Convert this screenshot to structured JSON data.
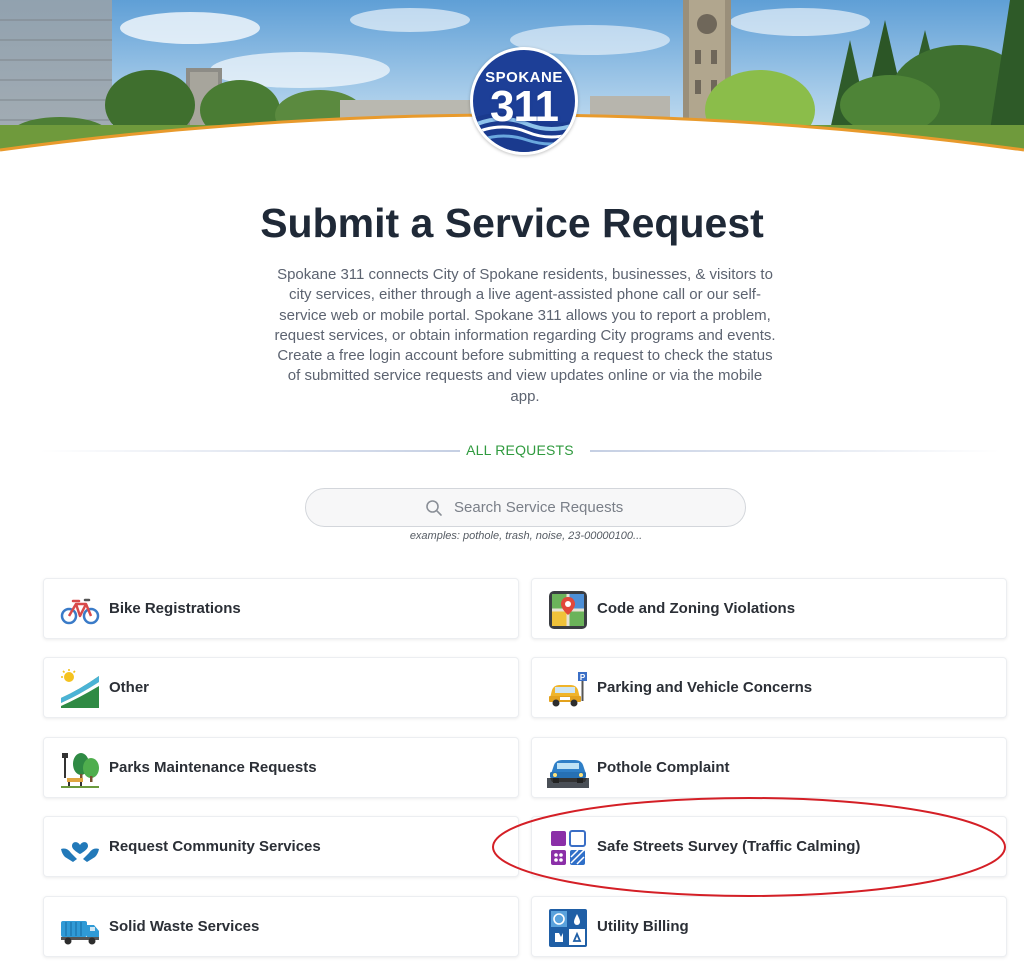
{
  "logo": {
    "top_text": "SPOKANE",
    "number": "311"
  },
  "page": {
    "title": "Submit a Service Request",
    "intro": "Spokane 311 connects City of Spokane residents, businesses, & visitors to city services, either through a live agent-assisted phone call or our self-service web or mobile portal. Spokane 311 allows you to report a problem, request services, or obtain information regarding City programs and events. Create a free login account before submitting a request to check the status of submitted service requests and view updates online or via the mobile app."
  },
  "divider": {
    "label": "ALL REQUESTS"
  },
  "search": {
    "placeholder": "Search Service Requests",
    "examples": "examples: pothole, trash, noise, 23-00000100..."
  },
  "requests": [
    {
      "label": "Bike Registrations",
      "icon": "bicycle-icon"
    },
    {
      "label": "Code and Zoning Violations",
      "icon": "map-pin-icon"
    },
    {
      "label": "Other",
      "icon": "hillside-icon"
    },
    {
      "label": "Parking and Vehicle Concerns",
      "icon": "parking-car-icon"
    },
    {
      "label": "Parks Maintenance Requests",
      "icon": "park-trees-icon"
    },
    {
      "label": "Pothole Complaint",
      "icon": "car-pothole-icon"
    },
    {
      "label": "Request Community Services",
      "icon": "heart-hands-icon"
    },
    {
      "label": "Safe Streets Survey (Traffic Calming)",
      "icon": "traffic-blocks-icon"
    },
    {
      "label": "Solid Waste Services",
      "icon": "garbage-truck-icon"
    },
    {
      "label": "Utility Billing",
      "icon": "utility-grid-icon"
    }
  ],
  "colors": {
    "title": "#1f2937",
    "divider_label": "#2f9a3e",
    "logo_blue": "#1d3f97",
    "banner_curve": "#e89a2c",
    "highlight": "#d41f26"
  }
}
